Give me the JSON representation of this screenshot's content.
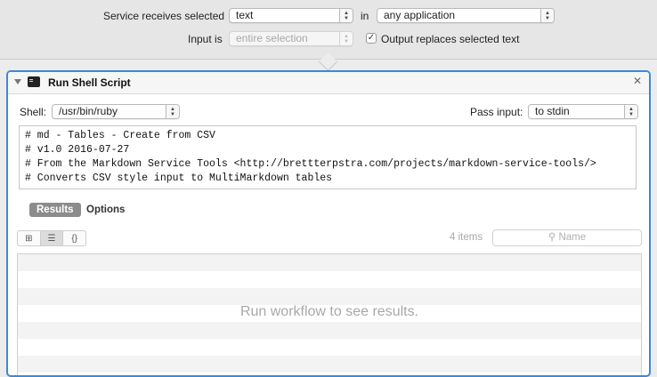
{
  "header": {
    "service_label": "Service receives selected",
    "service_value": "text",
    "in_label": "in",
    "app_value": "any application",
    "input_label": "Input is",
    "input_value": "entire selection",
    "output_checkbox_label": "Output replaces selected text",
    "output_checked": true
  },
  "action": {
    "title": "Run Shell Script",
    "shell_label": "Shell:",
    "shell_value": "/usr/bin/ruby",
    "pass_input_label": "Pass input:",
    "pass_input_value": "to stdin",
    "script_lines": [
      "# md - Tables - Create from CSV",
      "# v1.0 2016-07-27",
      "# From the Markdown Service Tools <http://brettterpstra.com/projects/markdown-service-tools/>",
      "# Converts CSV style input to MultiMarkdown tables"
    ],
    "tabs": [
      {
        "label": "Results",
        "active": true
      },
      {
        "label": "Options",
        "active": false
      }
    ],
    "view_modes": [
      {
        "icon": "grid-view-icon",
        "glyph": "⊞",
        "selected": false
      },
      {
        "icon": "list-view-icon",
        "glyph": "☰",
        "selected": true
      },
      {
        "icon": "code-view-icon",
        "glyph": "{}",
        "selected": false
      }
    ],
    "items_count": "4 items",
    "search_placeholder": "Name",
    "empty_message": "Run workflow to see results."
  },
  "colors": {
    "accent_border": "#3b8ad9",
    "tab_active_bg": "#8c8c8c"
  }
}
